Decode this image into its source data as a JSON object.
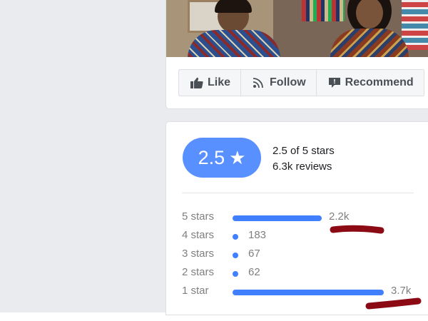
{
  "actions": [
    {
      "label": "Like",
      "icon": "thumbs-up-icon"
    },
    {
      "label": "Follow",
      "icon": "rss-icon"
    },
    {
      "label": "Recommend",
      "icon": "speech-bubble-icon"
    }
  ],
  "rating": {
    "score": "2.5",
    "summary": "2.5 of 5 stars",
    "reviews": "6.3k reviews",
    "star_glyph": "★"
  },
  "breakdown": [
    {
      "label": "5 stars",
      "count": "2.2k",
      "fraction": 0.59
    },
    {
      "label": "4 stars",
      "count": "183",
      "fraction": 0.0
    },
    {
      "label": "3 stars",
      "count": "67",
      "fraction": 0.0
    },
    {
      "label": "2 stars",
      "count": "62",
      "fraction": 0.0
    },
    {
      "label": "1 star",
      "count": "3.7k",
      "fraction": 1.0
    }
  ],
  "colors": {
    "accent": "#5890ff",
    "bar": "#4080ff",
    "annotation": "#8b0a14"
  }
}
